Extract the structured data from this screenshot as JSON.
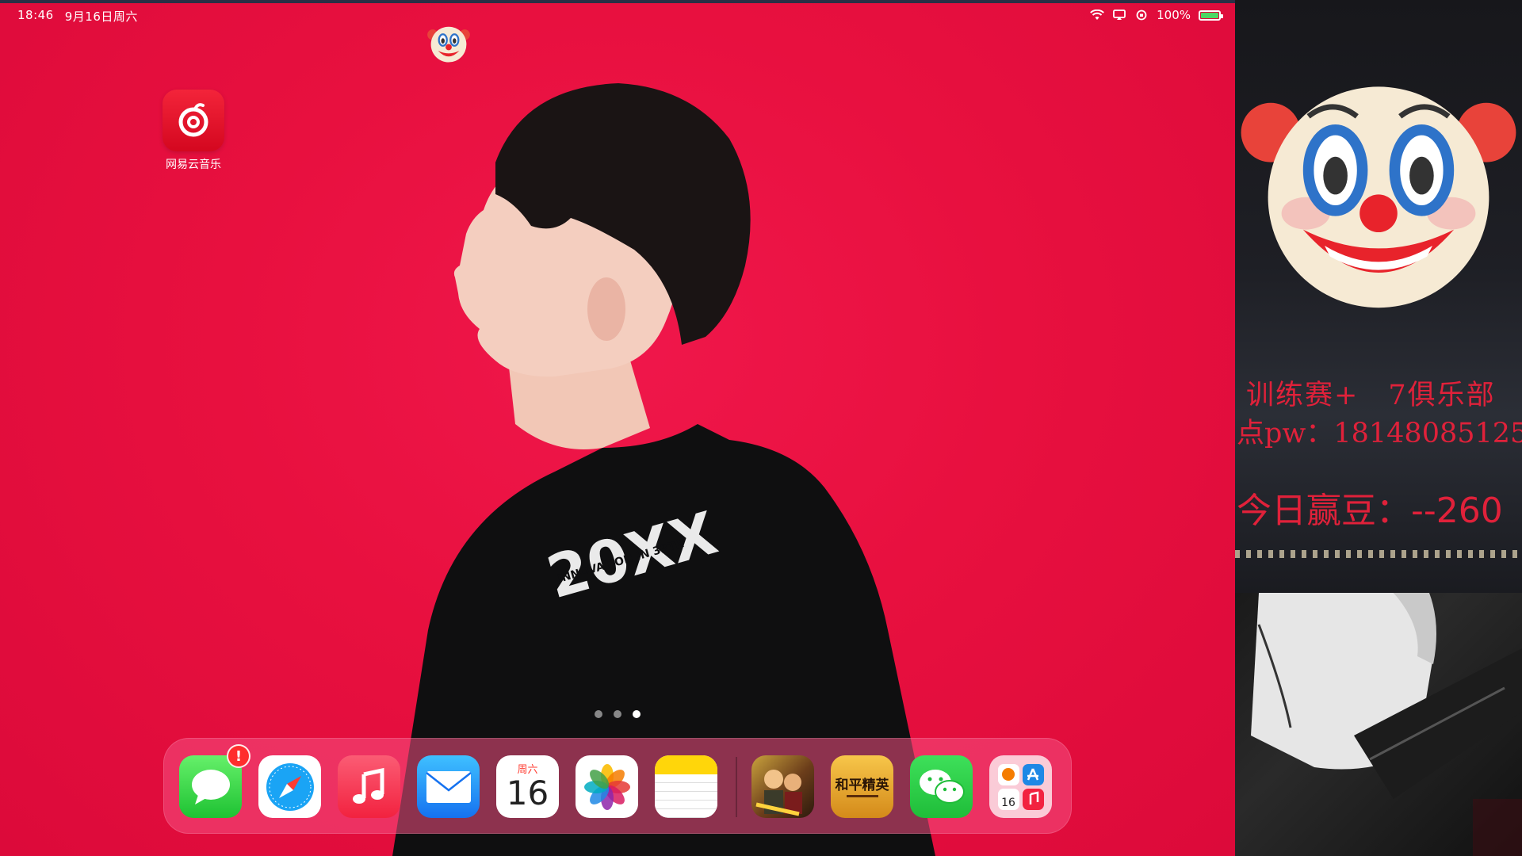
{
  "status_bar": {
    "time": "18:46",
    "date": "9月16日周六",
    "battery": "100%"
  },
  "home": {
    "apps": [
      {
        "label": "网易云音乐",
        "icon": "netease-music-icon"
      }
    ],
    "page_dots": {
      "count": 3,
      "active_index": 3
    }
  },
  "dock": {
    "apps": [
      {
        "name": "messages",
        "icon": "messages-icon",
        "badge": "!"
      },
      {
        "name": "safari",
        "icon": "safari-icon"
      },
      {
        "name": "music",
        "icon": "music-icon"
      },
      {
        "name": "mail",
        "icon": "mail-icon"
      },
      {
        "name": "calendar",
        "icon": "calendar-icon",
        "weekday": "周六",
        "day": "16"
      },
      {
        "name": "photos",
        "icon": "photos-icon"
      },
      {
        "name": "notes",
        "icon": "notes-icon"
      },
      {
        "name": "pubg-mobile",
        "icon": "game-icon"
      },
      {
        "name": "game-for-peace",
        "icon": "game-icon",
        "label": "和平精英"
      },
      {
        "name": "wechat",
        "icon": "wechat-icon"
      },
      {
        "name": "app-library",
        "icon": "app-library-icon",
        "mini_day": "16"
      }
    ]
  },
  "wallpaper": {
    "shirt_text": "20XX",
    "shirt_subtext": "INNOVATION IN 33TH"
  },
  "overlay": {
    "line1": "训练赛+　7俱乐部",
    "line2": "点pw：18148085125",
    "beans": "今日赢豆：--260"
  },
  "colors": {
    "wallpaper": "#e8103f",
    "overlay_text": "#e0213a",
    "dock": "#f5508c"
  }
}
